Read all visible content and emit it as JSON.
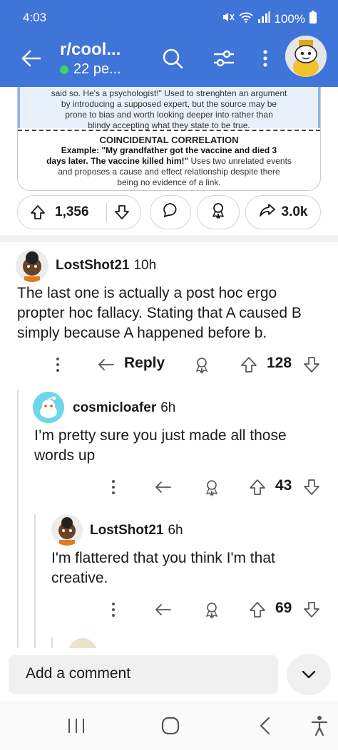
{
  "status": {
    "time": "4:03",
    "battery": "100%"
  },
  "header": {
    "title": "r/cool...",
    "members": "22 pe..."
  },
  "post_card": {
    "line1": "said so. He's a psychologist!\" Used to strenghten an argument",
    "line2": "by introducing a supposed expert, but the source may be",
    "line3": "prone to bias and worth looking deeper into rather than",
    "line4": "blindy accepting what they state to be true.",
    "heading": "COINCIDENTAL CORRELATION",
    "ex_label": "Example:",
    "ex_line1": "\"My grandfather got the vaccine and died 3",
    "ex_line2": "days later. The vaccine killed him!\"",
    "ex_rest1": " Uses two unrelated events",
    "ex_rest2": "and proposes a cause and effect relationship despite there",
    "ex_rest3": "being no evidence of a link."
  },
  "post_actions": {
    "upvotes": "1,356",
    "shares": "3.0k"
  },
  "comments": [
    {
      "author": "LostShot21",
      "age": "10h",
      "text": "The last one is actually a post hoc ergo propter hoc fallacy. Stating that A caused B simply because A happened before b.",
      "reply_label": "Reply",
      "votes": "128"
    },
    {
      "author": "cosmicloafer",
      "age": "6h",
      "text": "I’m pretty sure you just made all those words up",
      "votes": "43"
    },
    {
      "author": "LostShot21",
      "age": "6h",
      "text": "I'm flattered that you think I'm that creative.",
      "votes": "69"
    }
  ],
  "composer": {
    "placeholder": "Add a comment"
  },
  "colors": {
    "header_bg": "#3f74d9",
    "online": "#46d160"
  }
}
